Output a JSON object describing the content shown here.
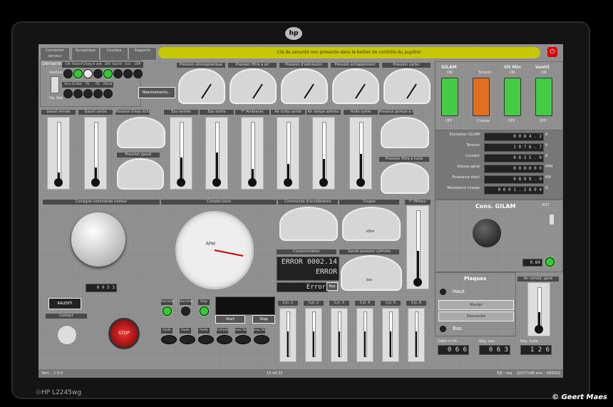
{
  "monitor": {
    "brand_logo": "hp",
    "model": "HP L2245wg",
    "credit": "© Geert Maes"
  },
  "toolbar": {
    "connect_label": "Connexion serveur",
    "buttons": [
      {
        "label": "Synoptique"
      },
      {
        "label": "Courbes"
      },
      {
        "label": "Rapports"
      }
    ],
    "alert": "Clé de sécurité non présente dans le boitier de contrôle du pupitre!",
    "close": "⏻"
  },
  "demarreur": {
    "title": "Démarreur",
    "labels": [
      "Clé",
      "Ralenti",
      "Charg",
      "A vide",
      "24V",
      "Surint.",
      "Isol",
      "LRP"
    ],
    "states": [
      "off",
      "on",
      "white",
      "off",
      "on",
      "off",
      "off",
      "off"
    ],
    "row2": [
      "Arcs",
      "Grillets",
      "P1",
      "P2",
      "Allnat"
    ],
    "left_top": "Gestion",
    "left_bottom": "Dp. Nat",
    "reset": "Réarmements..."
  },
  "pressure_headers": [
    "Pression atmosphérique",
    "Pression filtre à air",
    "Pression d'admission",
    "Pression échappement",
    "Pression carter"
  ],
  "thermo_headers": [
    "Gasoil entrée",
    "Gasoil sortie",
    "Pression d'eau échangeur",
    "Eau entrée",
    "Eau sortie",
    "T° Ambiante",
    "Air turbo sortie",
    "Air rampe admiss.",
    "Huile sortie",
    "Pression pompe à huile"
  ],
  "sub_gauges": [
    "Pression gasoil",
    "Pression filtre à huile"
  ],
  "gilam": {
    "switches": [
      {
        "top": "GILAM",
        "state_top": "ON",
        "bottom": "OFF",
        "color": "#4c4"
      },
      {
        "top": "",
        "state_top": "Tension",
        "bottom": "Charge",
        "color": "#e07020"
      },
      {
        "top": "Vit Min",
        "state_top": "ON",
        "bottom": "OFF",
        "color": "#4c4"
      },
      {
        "top": "Ventil",
        "state_top": "ON",
        "bottom": "OFF",
        "color": "#4c4"
      }
    ],
    "readouts": [
      {
        "label": "Excitation GILAM",
        "value": "0 0 8 4 . 2",
        "unit": "A"
      },
      {
        "label": "Tension",
        "value": "1 0 7 6 . 7",
        "unit": "V"
      },
      {
        "label": "Courant",
        "value": "0 8 3 5 . 0",
        "unit": "A"
      },
      {
        "label": "Vitesse géné",
        "value": "0 0 0 0 0 0",
        "unit": "PPM"
      },
      {
        "label": "Puissance élect",
        "value": "0 8 9 9 . 0",
        "unit": "KW"
      },
      {
        "label": "Résistance charge",
        "value": "0 0 0 1 . 2 8 9 4",
        "unit": "Ω"
      }
    ]
  },
  "engine": {
    "consigne_header": "Consigne commande moteur",
    "consigne_value": "0 9 5 3",
    "compte_tours_header": "Compte tours",
    "rpm_label": "RPM",
    "rpm_value": 1150,
    "accel_header": "Commande d'accélération",
    "couple_header": "Couple",
    "couple_unit": "kNm",
    "tmoteur_header": "T° Moteur",
    "conso_header": "Consommation",
    "conso_top": "ERROR",
    "conso_value": "0002.14",
    "conso_unit": "l/h",
    "error_text": "ERROR",
    "error2": "Error",
    "raz": "Raz",
    "sonde_header": "Sonde pression cylindre",
    "sonde_unit": "bar",
    "ralenti": "RALENTI",
    "contact": "Contact",
    "stop": "STOP",
    "knob_min": "0",
    "knob_max": "1"
  },
  "horaires": {
    "leds": [
      {
        "label": "Horaires OK",
        "on": true
      },
      {
        "label": "Horaires KO",
        "on": false
      },
      {
        "label": "Stop",
        "on": true
      }
    ],
    "start": "Start",
    "stop": "Stop",
    "ovals": [
      "Huile 1.5",
      "Huile 2.5",
      "Huile 2.75",
      "Cohnst.",
      "eau 50",
      "eau 56"
    ]
  },
  "cylinders": [
    "Cyl. 1",
    "Cyl. 2",
    "Cyl. 3",
    "Cyl. 4",
    "Cyl. 5",
    "Cyl. 6"
  ],
  "cons_gilam": {
    "title": "Cons. GILAM",
    "value": "0.84",
    "unit": "Cs. mpl",
    "rst": "RST"
  },
  "plaques": {
    "title": "Plaques",
    "haut": "Haut",
    "bas": "Bas",
    "monter": "Monter",
    "descendre": "Descendre",
    "temp_header": "Air refroid. géné"
  },
  "bottom_readouts": [
    {
      "label": "Débit m³/h",
      "value": "0 6 6"
    },
    {
      "label": "Rég. eau",
      "value": "0 6 3"
    },
    {
      "label": "Rég. huile",
      "value": "1 2 6"
    }
  ],
  "status_bar": {
    "version": "Vers. : 1.0.0",
    "time": "15:44:33",
    "right": "EJS : req. : 32577146   env. : 669302"
  }
}
